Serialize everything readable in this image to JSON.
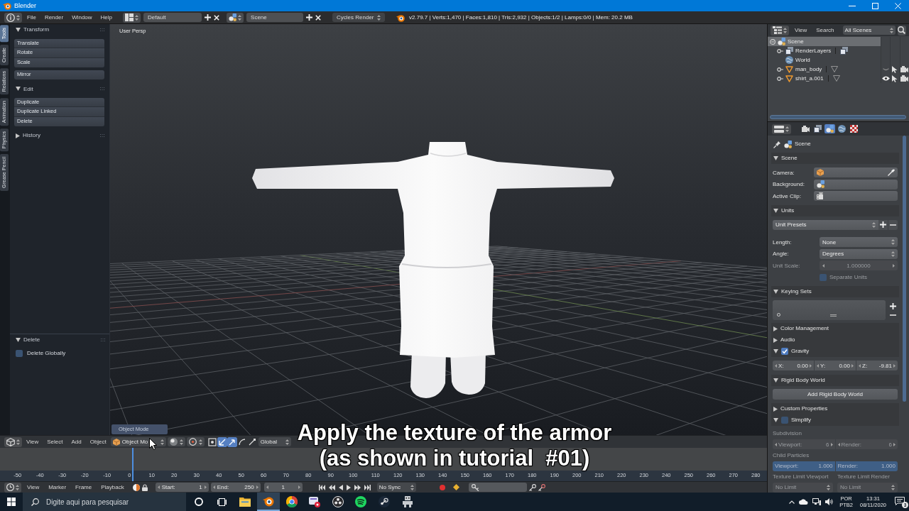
{
  "window": {
    "title": "Blender"
  },
  "info_header": {
    "menus": [
      "File",
      "Render",
      "Window",
      "Help"
    ],
    "screen_layout": "Default",
    "scene": "Scene",
    "render_engine": "Cycles Render",
    "stats": "v2.79.7 | Verts:1,470 | Faces:1,810 | Tris:2,932 | Objects:1/2 | Lamps:0/0 | Mem: 20.2 MB"
  },
  "tool_shelf": {
    "tabs": [
      {
        "label": "Tools",
        "selected": true
      },
      {
        "label": "Create",
        "selected": false
      },
      {
        "label": "Relations",
        "selected": false
      },
      {
        "label": "Animation",
        "selected": false
      },
      {
        "label": "Physics",
        "selected": false
      },
      {
        "label": "Grease Pencil",
        "selected": false
      }
    ],
    "panels": [
      {
        "title": "Transform",
        "expanded": true,
        "groups": [
          [
            "Translate",
            "Rotate",
            "Scale"
          ],
          [
            "Mirror"
          ]
        ]
      },
      {
        "title": "Edit",
        "expanded": true,
        "groups": [
          [
            "Duplicate",
            "Duplicate Linked",
            "Delete"
          ]
        ]
      },
      {
        "title": "History",
        "expanded": false
      }
    ]
  },
  "operator_panel": {
    "title": "Delete",
    "expanded": true,
    "options": [
      {
        "label": "Delete Globally",
        "checked": false
      }
    ]
  },
  "viewport": {
    "view_name": "User Persp",
    "mode_popup": "Object Mode"
  },
  "viewport_header": {
    "menus": [
      "View",
      "Select",
      "Add",
      "Object"
    ],
    "mode": "Object Mo",
    "transform_tools": [
      {
        "kind": "frame",
        "on": false
      },
      {
        "kind": "axes",
        "on": true
      },
      {
        "kind": "move",
        "on": true
      },
      {
        "kind": "rotate",
        "on": false
      },
      {
        "kind": "scale",
        "on": false
      }
    ],
    "orientation": "Global"
  },
  "caption": [
    "Apply the texture of the armor",
    "(as shown in tutorial  #01)"
  ],
  "timeline": {
    "playhead": {
      "level": 0.172
    },
    "ruler": [
      "-50",
      "-40",
      "-30",
      "-20",
      "-10",
      "0",
      "10",
      "20",
      "30",
      "40",
      "50",
      "60",
      "70",
      "80",
      "90",
      "100",
      "110",
      "120",
      "130",
      "140",
      "150",
      "160",
      "170",
      "180",
      "190",
      "200",
      "210",
      "220",
      "230",
      "240",
      "250",
      "260",
      "270",
      "280"
    ]
  },
  "timeline_header": {
    "menus": [
      "View",
      "Marker",
      "Frame",
      "Playback"
    ],
    "start": {
      "label": "Start:",
      "value": "1"
    },
    "end": {
      "label": "End:",
      "value": "250"
    },
    "current_frame": "1",
    "sync": "No Sync"
  },
  "outliner": {
    "menus": [
      "View",
      "Search"
    ],
    "filter": "All Scenes",
    "tree": [
      {
        "name": "Scene",
        "kind": "scene",
        "selected": true,
        "expanded": true,
        "children": [
          {
            "name": "RenderLayers",
            "kind": "renderlayers",
            "selected": false,
            "expanded": false
          },
          {
            "name": "World",
            "kind": "world",
            "selected": false
          },
          {
            "name": "man_body",
            "kind": "mesh",
            "selected": false,
            "expanded": false,
            "visible": false
          },
          {
            "name": "shirt_a.001",
            "kind": "mesh",
            "selected": false,
            "expanded": false,
            "visible": true
          }
        ]
      }
    ]
  },
  "properties": {
    "tabs": [
      {
        "kind": "render",
        "selected": false
      },
      {
        "kind": "layers",
        "selected": false
      },
      {
        "kind": "scene",
        "selected": true
      },
      {
        "kind": "world",
        "selected": false
      },
      {
        "kind": "texture",
        "selected": false
      }
    ],
    "context": "Scene",
    "panels": [
      {
        "title": "Scene",
        "kind": "plain",
        "expanded": true,
        "rows": [
          {
            "kind": "datablock",
            "label": "Camera:"
          },
          {
            "kind": "datablock",
            "label": "Background:"
          },
          {
            "kind": "datablock",
            "label": "Active Clip:"
          }
        ]
      },
      {
        "title": "Units",
        "kind": "plain",
        "expanded": true,
        "rows": [
          {
            "kind": "preset",
            "label": "Unit Presets",
            "disabled": false
          },
          {
            "kind": "dropdown",
            "label": "Length:",
            "value": "None",
            "disabled": false
          },
          {
            "kind": "dropdown",
            "label": "Angle:",
            "value": "Degrees",
            "disabled": false
          },
          {
            "kind": "number",
            "label": "Unit Scale:",
            "value": "1.000000",
            "disabled": true
          },
          {
            "kind": "checkbox",
            "label": "Separate Units",
            "checked": false,
            "disabled": true
          }
        ]
      },
      {
        "title": "Keying Sets",
        "kind": "plain",
        "expanded": true,
        "rows": [
          {
            "kind": "list"
          }
        ]
      },
      {
        "title": "Color Management",
        "kind": "plain",
        "expanded": false
      },
      {
        "title": "Audio",
        "kind": "plain",
        "expanded": false
      },
      {
        "title": "Gravity",
        "kind": "toggle",
        "checked": true,
        "expanded": true,
        "rows": [
          {
            "kind": "vector",
            "fields": [
              {
                "label": "X:",
                "value": "0.00"
              },
              {
                "label": "Y:",
                "value": "0.00"
              },
              {
                "label": "Z:",
                "value": "-9.81"
              }
            ]
          }
        ]
      },
      {
        "title": "Rigid Body World",
        "kind": "plain",
        "expanded": true,
        "rows": [
          {
            "kind": "button",
            "label": "Add Rigid Body World"
          }
        ]
      },
      {
        "title": "Custom Properties",
        "kind": "plain",
        "expanded": false
      },
      {
        "title": "Simplify",
        "kind": "toggle",
        "checked": false,
        "expanded": true,
        "rows": [
          {
            "kind": "heading",
            "label": "Subdivision"
          },
          {
            "kind": "numbers",
            "fields": [
              {
                "label": "Viewport:",
                "value": "6"
              },
              {
                "label": "Render:",
                "value": "6"
              }
            ]
          },
          {
            "kind": "heading",
            "label": "Child Particles"
          },
          {
            "kind": "sliders",
            "fields": [
              {
                "label": "Viewport:",
                "value": "1.000",
                "level": 1
              },
              {
                "label": "Render:",
                "value": "1.000",
                "level": 1
              }
            ]
          },
          {
            "kind": "headings",
            "labels": [
              "Texture Limit Viewport",
              "Texture Limit Render"
            ]
          },
          {
            "kind": "dropdowns",
            "values": [
              "No Limit",
              "No Limit"
            ]
          }
        ]
      }
    ]
  },
  "taskbar": {
    "search_placeholder": "Digite aqui para pesquisar",
    "apps": [
      {
        "kind": "folder",
        "selected": false
      },
      {
        "kind": "orbit",
        "selected": true
      },
      {
        "kind": "wheel",
        "selected": false
      },
      {
        "kind": "badge",
        "selected": false
      },
      {
        "kind": "aperture",
        "selected": false
      },
      {
        "kind": "waves",
        "selected": false
      },
      {
        "kind": "piston",
        "selected": false
      },
      {
        "kind": "figure",
        "selected": false
      }
    ],
    "language": [
      "POR",
      "PTB2"
    ],
    "time": "13:31",
    "date": "08/11/2020",
    "notifications": "3"
  }
}
